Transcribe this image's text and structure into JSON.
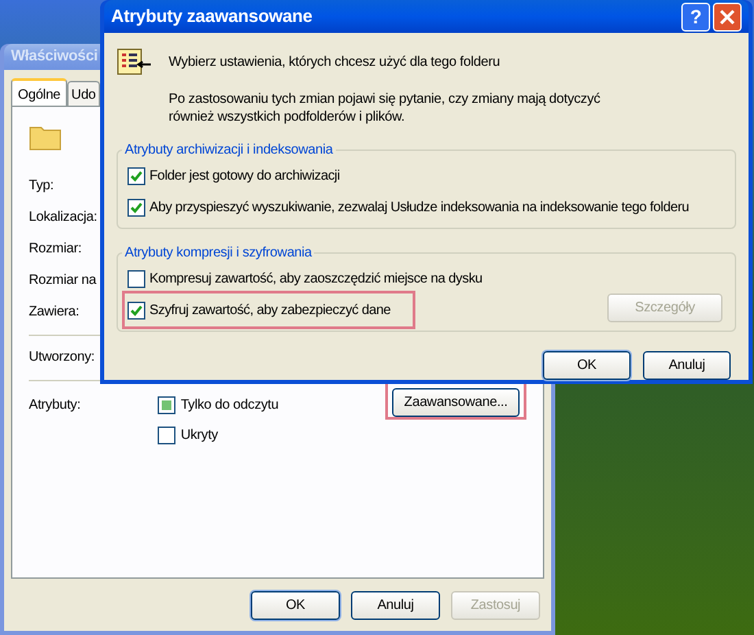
{
  "properties_window": {
    "title": "Właściwości",
    "active": false,
    "tabs": [
      {
        "label": "Ogólne",
        "selected": true
      },
      {
        "label": "Udo",
        "selected": false
      }
    ],
    "fields": [
      {
        "label": "Typ:"
      },
      {
        "label": "Lokalizacja:"
      },
      {
        "label": "Rozmiar:"
      },
      {
        "label": "Rozmiar na"
      },
      {
        "label": "Zawiera:"
      },
      {
        "label": "Utworzony:"
      }
    ],
    "attributes_label": "Atrybuty:",
    "attributes": [
      {
        "label": "Tylko do odczytu",
        "checked": false,
        "indeterminate": true
      },
      {
        "label": "Ukryty",
        "checked": false,
        "indeterminate": false
      }
    ],
    "advanced_button": {
      "label": "Zaawansowane...",
      "highlighted": true
    },
    "buttons": [
      {
        "label": "OK",
        "disabled": false,
        "default": true
      },
      {
        "label": "Anuluj",
        "disabled": false,
        "default": false
      },
      {
        "label": "Zastosuj",
        "disabled": true,
        "default": false
      }
    ]
  },
  "advanced_dialog": {
    "title": "Atrybuty zaawansowane",
    "active": true,
    "help_button": "?",
    "intro": "Wybierz ustawienia, których chcesz użyć dla tego folderu",
    "note": "Po zastosowaniu tych zmian pojawi się pytanie, czy zmiany mają dotyczyć również wszystkich podfolderów i plików.",
    "groups": [
      {
        "title": "Atrybuty archiwizacji i indeksowania",
        "options": [
          {
            "label": "Folder jest gotowy do archiwizacji",
            "checked": true,
            "highlighted": false
          },
          {
            "label": "Aby przyspieszyć wyszukiwanie, zezwalaj Usłudze indeksowania na indeksowanie tego folderu",
            "checked": true,
            "highlighted": false
          }
        ]
      },
      {
        "title": "Atrybuty kompresji i szyfrowania",
        "details_button": {
          "label": "Szczegóły",
          "disabled": true
        },
        "options": [
          {
            "label": "Kompresuj zawartość, aby zaoszczędzić miejsce na dysku",
            "checked": false,
            "highlighted": false
          },
          {
            "label": "Szyfruj zawartość, aby zabezpieczyć dane",
            "checked": true,
            "highlighted": true
          }
        ]
      }
    ],
    "buttons": [
      {
        "label": "OK",
        "disabled": false,
        "default": true
      },
      {
        "label": "Anuluj",
        "disabled": false,
        "default": false
      }
    ]
  }
}
